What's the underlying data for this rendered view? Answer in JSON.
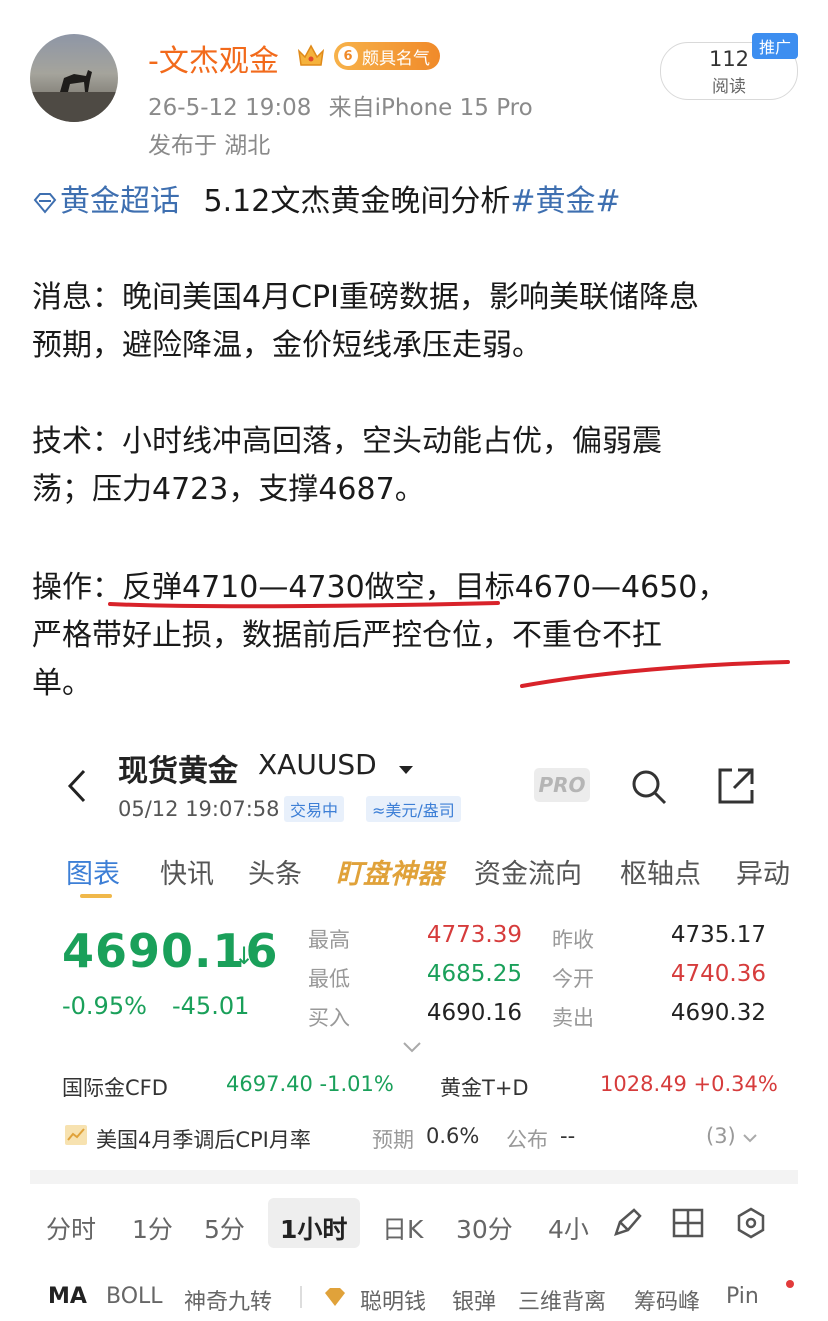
{
  "post": {
    "username": "-文杰观金",
    "level": "6",
    "level_badge": "颇具名气",
    "timestamp": "26-5-12 19:08",
    "source": "来自iPhone 15 Pro",
    "location": "发布于 湖北",
    "read_count": "112",
    "read_label": "阅读",
    "promo_tag": "推广",
    "topic_link": "黄金超话",
    "title_text": "5.12文杰黄金晚间分析",
    "hashtag": "#黄金#",
    "para1_line1": "消息：晚间美国4月CPI重磅数据，影响美联储降息",
    "para1_line2": "预期，避险降温，金价短线承压走弱。",
    "para2_line1": "技术：小时线冲高回落，空头动能占优，偏弱震",
    "para2_line2": "荡；压力4723，支撑4687。",
    "para3_line1": "操作：反弹4710—4730做空，目标4670—4650，",
    "para3_line2": "严格带好止损，数据前后严控仓位，不重仓不扛",
    "para3_line3": "单。"
  },
  "quote": {
    "title": "现货黄金",
    "symbol": "XAUUSD",
    "time": "05/12 19:07:58",
    "status_tag": "交易中",
    "unit_tag": "≈美元/盎司",
    "pro_label": "PRO",
    "tabs": [
      "图表",
      "快讯",
      "头条",
      "盯盘神器",
      "资金流向",
      "枢轴点",
      "异动"
    ],
    "price": "4690.16",
    "price_arrow": "↓",
    "change_pct": "-0.95%",
    "change_abs": "-45.01",
    "stats": {
      "high_label": "最高",
      "high": "4773.39",
      "low_label": "最低",
      "low": "4685.25",
      "bid_label": "买入",
      "bid": "4690.16",
      "prev_close_label": "昨收",
      "prev_close": "4735.17",
      "open_label": "今开",
      "open": "4740.36",
      "ask_label": "卖出",
      "ask": "4690.32"
    },
    "cfd_label": "国际金CFD",
    "cfd_value": "4697.40 -1.01%",
    "td_label": "黄金T+D",
    "td_value": "1028.49 +0.34%",
    "event_title": "美国4月季调后CPI月率",
    "event_forecast_label": "预期",
    "event_forecast": "0.6%",
    "event_publish_label": "公布",
    "event_publish": "--",
    "event_count": "(3)",
    "periods": [
      "分时",
      "1分",
      "5分",
      "1小时",
      "日K",
      "30分",
      "4小"
    ],
    "indicators": [
      "MA",
      "BOLL",
      "神奇九转",
      "聪明钱",
      "银弹",
      "三维背离",
      "筹码峰",
      "Pin"
    ]
  },
  "colors": {
    "orange_name": "#f26a1b",
    "link_blue": "#3e6fb0",
    "up_red": "#d63c3c",
    "down_green": "#1aa05a",
    "underline_red": "#d8232a"
  }
}
